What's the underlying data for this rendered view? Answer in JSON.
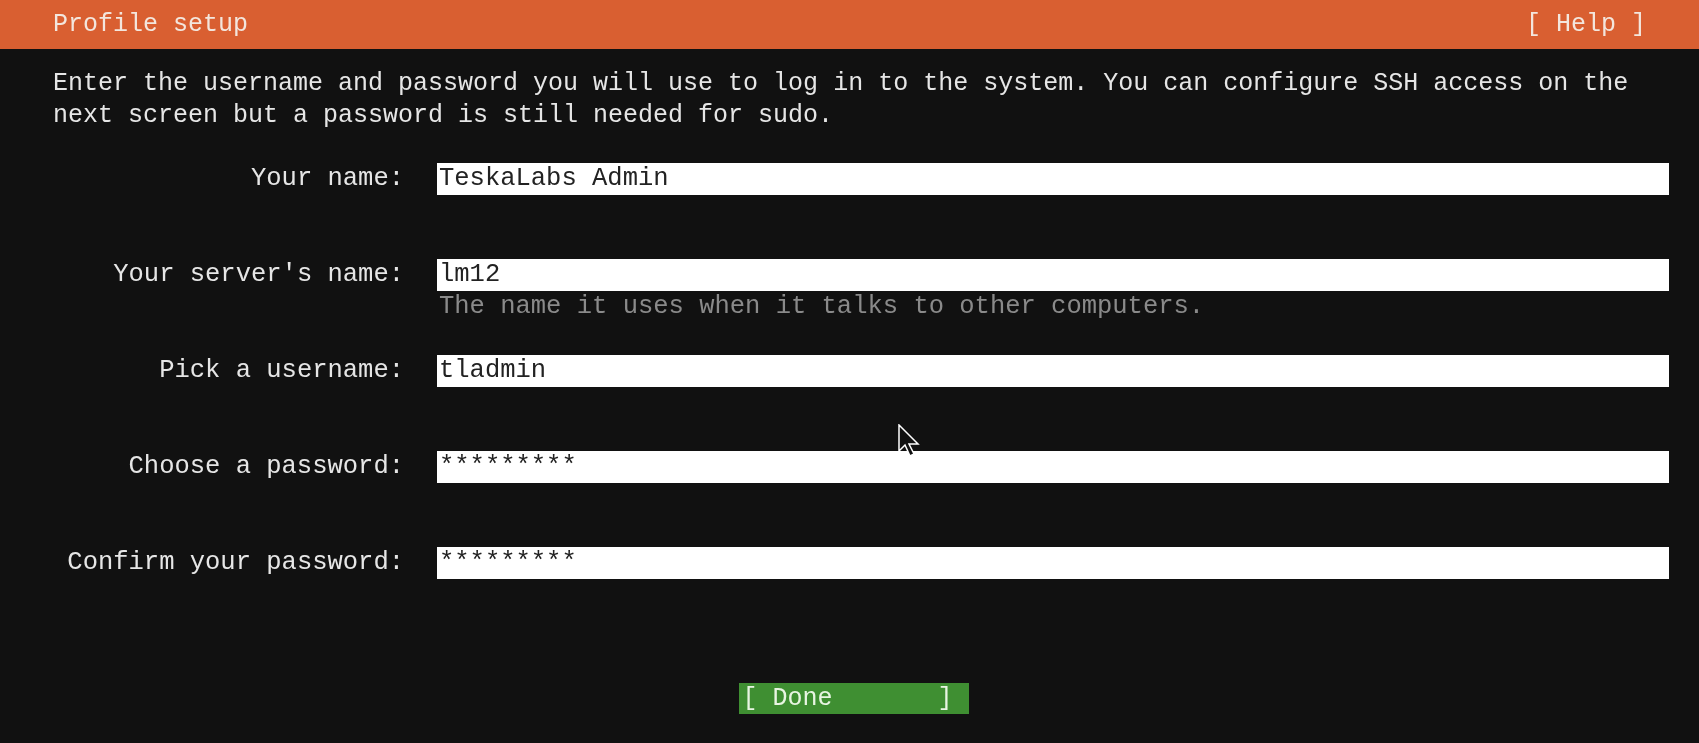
{
  "header": {
    "title": "Profile setup",
    "help": "[ Help ]"
  },
  "intro": "Enter the username and password you will use to log in to the system. You can configure SSH access on the next screen but a password is still needed for sudo.",
  "fields": [
    {
      "label": "Your name:",
      "value": "TeskaLabs Admin"
    },
    {
      "label": "Your server's name:",
      "value": "lm12",
      "hint": "The name it uses when it talks to other computers."
    },
    {
      "label": "Pick a username:",
      "value": "tladmin"
    },
    {
      "label": "Choose a password:",
      "value": "*********"
    },
    {
      "label": "Confirm your password:",
      "value": "*********"
    }
  ],
  "done_button": {
    "label": "[ Done       ]",
    "selected": true
  }
}
